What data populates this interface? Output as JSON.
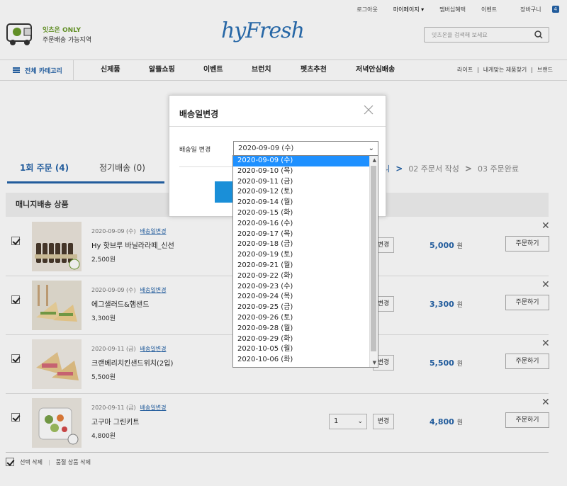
{
  "util": {
    "logout": "로그아웃",
    "mypage": "마이페이지 ▾",
    "membership": "멤버십혜택",
    "event": "이벤트",
    "cart": "장바구니",
    "cart_count": "4"
  },
  "promo": {
    "line1": "잇츠온 ONLY",
    "line2": "주문배송 가능지역"
  },
  "logo": "hyFresh",
  "search": {
    "placeholder": "잇츠온을 검색해 보세요"
  },
  "nav": {
    "category": "전체 카테고리",
    "items": [
      "신제품",
      "알뜰쇼핑",
      "이벤트",
      "브런치",
      "펫츠추천",
      "저녁안심배송"
    ],
    "right": [
      "라이프",
      "내게맞는 제품찾기",
      "브랜드"
    ]
  },
  "tabs": {
    "t1": "1회 주문 (4)",
    "t2": "정기배송 (0)"
  },
  "steps": {
    "s1": "구니",
    "s2": "02 주문서 작성",
    "s3": "03 주문완료"
  },
  "section": {
    "title": "매니지배송 상품"
  },
  "rows": [
    {
      "date": "2020-09-09 (수)",
      "link": "배송일변경",
      "name": "Hy 핫브루 바닐라라떼_신선",
      "price": "2,500원",
      "total": "5,000",
      "won": "원"
    },
    {
      "date": "2020-09-09 (수)",
      "link": "배송일변경",
      "name": "에그샐러드&햄샌드",
      "price": "3,300원",
      "total": "3,300",
      "won": "원"
    },
    {
      "date": "2020-09-11 (금)",
      "link": "배송일변경",
      "name": "크랜베리치킨샌드위치(2입)",
      "price": "5,500원",
      "total": "5,500",
      "won": "원"
    },
    {
      "date": "2020-09-11 (금)",
      "link": "배송일변경",
      "name": "고구마 그린키트",
      "price": "4,800원",
      "total": "4,800",
      "won": "원",
      "qty": "1"
    }
  ],
  "row_buttons": {
    "change": "변경",
    "order": "주문하기"
  },
  "bottom": {
    "select_delete": "선택 삭제",
    "sold_delete": "품절 상품 삭제"
  },
  "modal": {
    "title": "배송일변경",
    "label": "배송일 변경",
    "selected": "2020-09-09 (수)"
  },
  "options": [
    "2020-09-09 (수)",
    "2020-09-10 (목)",
    "2020-09-11 (금)",
    "2020-09-12 (토)",
    "2020-09-14 (월)",
    "2020-09-15 (화)",
    "2020-09-16 (수)",
    "2020-09-17 (목)",
    "2020-09-18 (금)",
    "2020-09-19 (토)",
    "2020-09-21 (월)",
    "2020-09-22 (화)",
    "2020-09-23 (수)",
    "2020-09-24 (목)",
    "2020-09-25 (금)",
    "2020-09-26 (토)",
    "2020-09-28 (월)",
    "2020-09-29 (화)",
    "2020-10-05 (월)",
    "2020-10-06 (화)"
  ],
  "colors": {
    "accent": "#2563a8",
    "selected": "#1e90ff",
    "promo_green": "#6a9a2a",
    "modal_button": "#1a8fd8"
  }
}
